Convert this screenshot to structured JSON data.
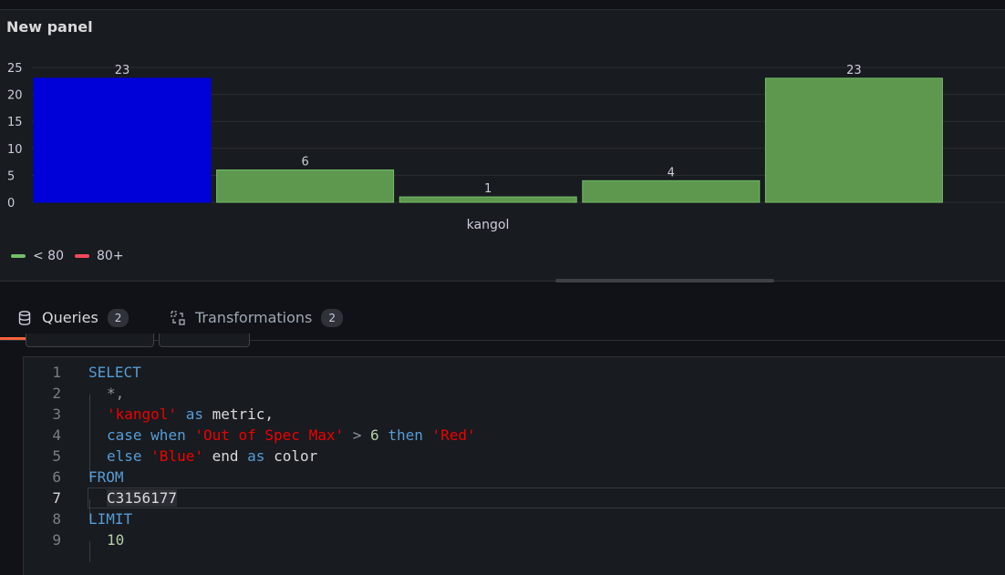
{
  "panel": {
    "title": "New panel",
    "legend": [
      {
        "label": "< 80",
        "color": "#73bf69"
      },
      {
        "label": "80+",
        "color": "#f2495c"
      }
    ]
  },
  "chart_data": {
    "type": "bar",
    "xlabel": "kangol",
    "ylabel": "",
    "ylim": [
      0,
      25
    ],
    "yticks": [
      "25",
      "20",
      "15",
      "10",
      "5",
      "0"
    ],
    "values": [
      23,
      6,
      1,
      4,
      23
    ],
    "value_labels": [
      "23",
      "6",
      "1",
      "4",
      "23"
    ],
    "colors": [
      "#0000d8",
      "#629e51",
      "#629e51",
      "#629e51",
      "#629e51"
    ]
  },
  "tabs": [
    {
      "label": "Queries",
      "count": "2",
      "icon": "database-icon",
      "active": true
    },
    {
      "label": "Transformations",
      "count": "2",
      "icon": "transform-icon",
      "active": false
    }
  ],
  "editor": {
    "lines": [
      {
        "n": "1"
      },
      {
        "n": "2"
      },
      {
        "n": "3"
      },
      {
        "n": "4"
      },
      {
        "n": "5"
      },
      {
        "n": "6"
      },
      {
        "n": "7"
      },
      {
        "n": "8"
      },
      {
        "n": "9"
      }
    ],
    "tokens": {
      "select": "SELECT",
      "star": "*,",
      "kangol": "'kangol'",
      "as1": "as",
      "metric": "metric,",
      "case": "case",
      "when": "when",
      "oos": "'Out of Spec Max'",
      "gt": ">",
      "six": "6",
      "then": "then",
      "red": "'Red'",
      "else": "else",
      "blue": "'Blue'",
      "end": "end",
      "as2": "as",
      "color": "color",
      "from": "FROM",
      "table": "C3156177",
      "limit": "LIMIT",
      "ten": "10"
    }
  }
}
